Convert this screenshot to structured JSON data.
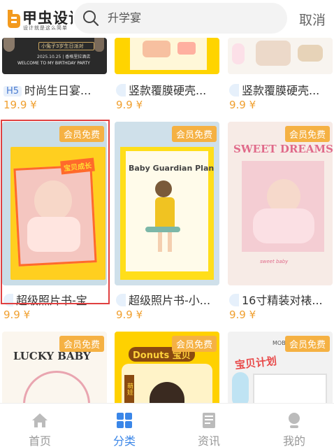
{
  "header": {
    "logo_title": "甲虫设计",
    "logo_subtitle": "设计就是这么简单",
    "search_value": "升学宴",
    "cancel_label": "取消"
  },
  "cards": [
    {
      "title": "时尚生日宴...",
      "price": "19.9 ¥",
      "tag": "H5",
      "thumb_text": [
        "小兔子3岁生日派对",
        "2025.10.25 | 香格里拉酒店",
        "WELCOME TO MY BIRTHDAY PARTY"
      ]
    },
    {
      "title": "竖款覆膜硬壳...",
      "price": "9.9 ¥"
    },
    {
      "title": "竖款覆膜硬壳...",
      "price": "9.9 ¥"
    },
    {
      "title": "超级照片书-宝...",
      "price": "9.9 ¥",
      "badge": "会员免费",
      "thumb_text": [
        "宝贝成长"
      ]
    },
    {
      "title": "超级照片书-小...",
      "price": "9.9 ¥",
      "badge": "会员免费",
      "thumb_text": [
        "Baby Guardian Plan"
      ]
    },
    {
      "title": "16寸精装对裱...",
      "price": "9.9 ¥",
      "badge": "会员免费",
      "thumb_text": [
        "SWEET DREAMS",
        "sweet baby"
      ]
    },
    {
      "badge": "会员免费",
      "thumb_text": [
        "LUCKY BABY"
      ]
    },
    {
      "badge": "会员免费",
      "thumb_text": [
        "Donuts",
        "宝贝",
        "萌娃"
      ]
    },
    {
      "badge": "会员免费",
      "thumb_text": [
        "宝贝计划",
        "MOBILE"
      ]
    }
  ],
  "tabs": [
    {
      "label": "首页",
      "icon": "home-icon"
    },
    {
      "label": "分类",
      "icon": "category-icon"
    },
    {
      "label": "资讯",
      "icon": "news-icon"
    },
    {
      "label": "我的",
      "icon": "profile-icon"
    }
  ],
  "colors": {
    "accent": "#3a86e8",
    "price": "#f0a030",
    "badge": "#f5b143",
    "selection": "#e04040"
  }
}
